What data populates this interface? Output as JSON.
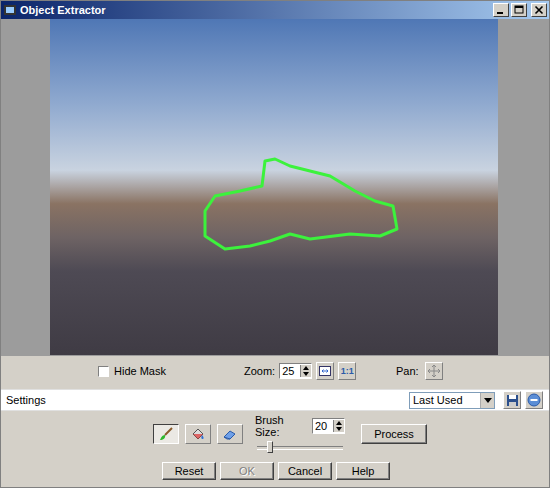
{
  "window": {
    "title": "Object Extractor"
  },
  "view": {
    "hide_mask": {
      "label": "Hide Mask",
      "checked": false
    },
    "zoom": {
      "label": "Zoom:",
      "value": "25",
      "actual_size": "1:1"
    },
    "pan": {
      "label": "Pan:"
    }
  },
  "settings": {
    "label": "Settings",
    "preset": "Last Used"
  },
  "tools": [
    {
      "kind": "brush",
      "selected": true
    },
    {
      "kind": "fill",
      "selected": false
    },
    {
      "kind": "eraser",
      "selected": false
    }
  ],
  "brush": {
    "label": "Brush Size:",
    "value": "20",
    "level": 0.15
  },
  "process_button": {
    "label": "Process",
    "disabled": false
  },
  "buttons": [
    {
      "label": "Reset",
      "disabled": false
    },
    {
      "label": "OK",
      "disabled": true
    },
    {
      "label": "Cancel",
      "disabled": false
    },
    {
      "label": "Help",
      "disabled": false
    }
  ]
}
